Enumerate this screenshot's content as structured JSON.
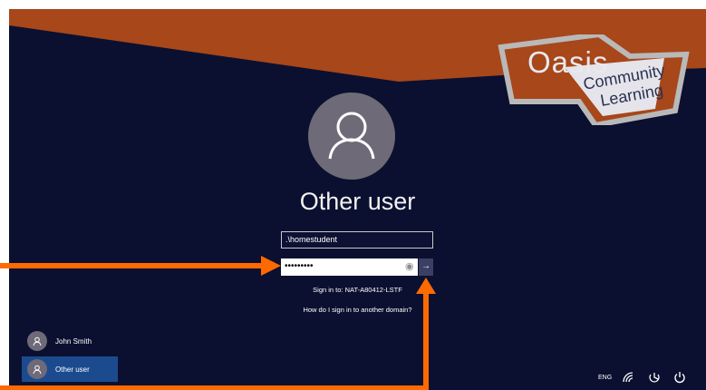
{
  "brand": {
    "line1": "Oasis",
    "line2": "Community",
    "line3": "Learning"
  },
  "login": {
    "title": "Other user",
    "username_value": ".\\homestudent",
    "password_value": "•••••••••",
    "submit_icon": "arrow-right-icon",
    "reveal_icon": "eye-icon",
    "sign_in_to": "Sign in to: NAT-A80412-LSTF",
    "other_domain_link": "How do I sign in to another domain?"
  },
  "users": [
    {
      "name": "John Smith",
      "selected": false
    },
    {
      "name": "Other user",
      "selected": true
    }
  ],
  "tray": {
    "language": "ENG",
    "icons": [
      "network-icon",
      "ease-of-access-icon",
      "power-icon"
    ]
  },
  "colors": {
    "background": "#0b1030",
    "brand_band": "#a7471a",
    "annotation_arrow": "#ff6a00",
    "selected_tile": "#1b4b8e"
  }
}
